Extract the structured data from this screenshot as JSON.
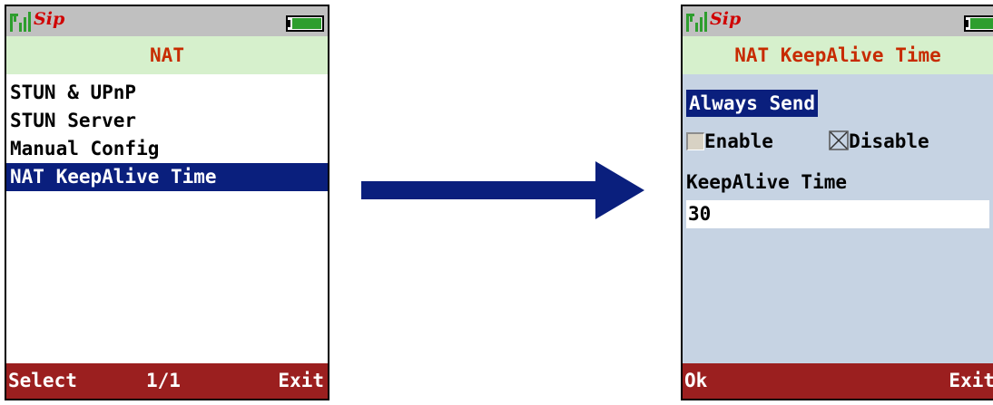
{
  "left_screen": {
    "status": {
      "sip_logo": "Sip",
      "signal_icon": "signal-bars-icon",
      "battery_icon": "battery-icon"
    },
    "title": "NAT",
    "menu_items": [
      {
        "label": "STUN & UPnP"
      },
      {
        "label": "STUN Server"
      },
      {
        "label": "Manual Config"
      },
      {
        "label": "NAT KeepAlive Time",
        "selected": true
      }
    ],
    "softkeys": {
      "left": "Select",
      "middle": "1/1",
      "right": "Exit"
    }
  },
  "transition": {
    "icon": "right-arrow-icon",
    "color": "#0a1f7d"
  },
  "right_screen": {
    "status": {
      "sip_logo": "Sip",
      "signal_icon": "signal-bars-icon",
      "battery_icon": "battery-icon"
    },
    "title": "NAT KeepAlive Time",
    "option_label": "Always Send",
    "enable_label": "Enable",
    "disable_label": "Disable",
    "selected_option": "Disable",
    "field_label": "KeepAlive Time",
    "field_value": "30",
    "softkeys": {
      "left": "Ok",
      "right": "Exit"
    }
  },
  "colors": {
    "title_bg": "#d6f0cc",
    "title_text": "#c72b00",
    "selection_bg": "#0a1f7d",
    "softkey_bg": "#9b1f1f",
    "battery_fill": "#2e9e2e",
    "settings_bg": "#c6d3e3"
  }
}
